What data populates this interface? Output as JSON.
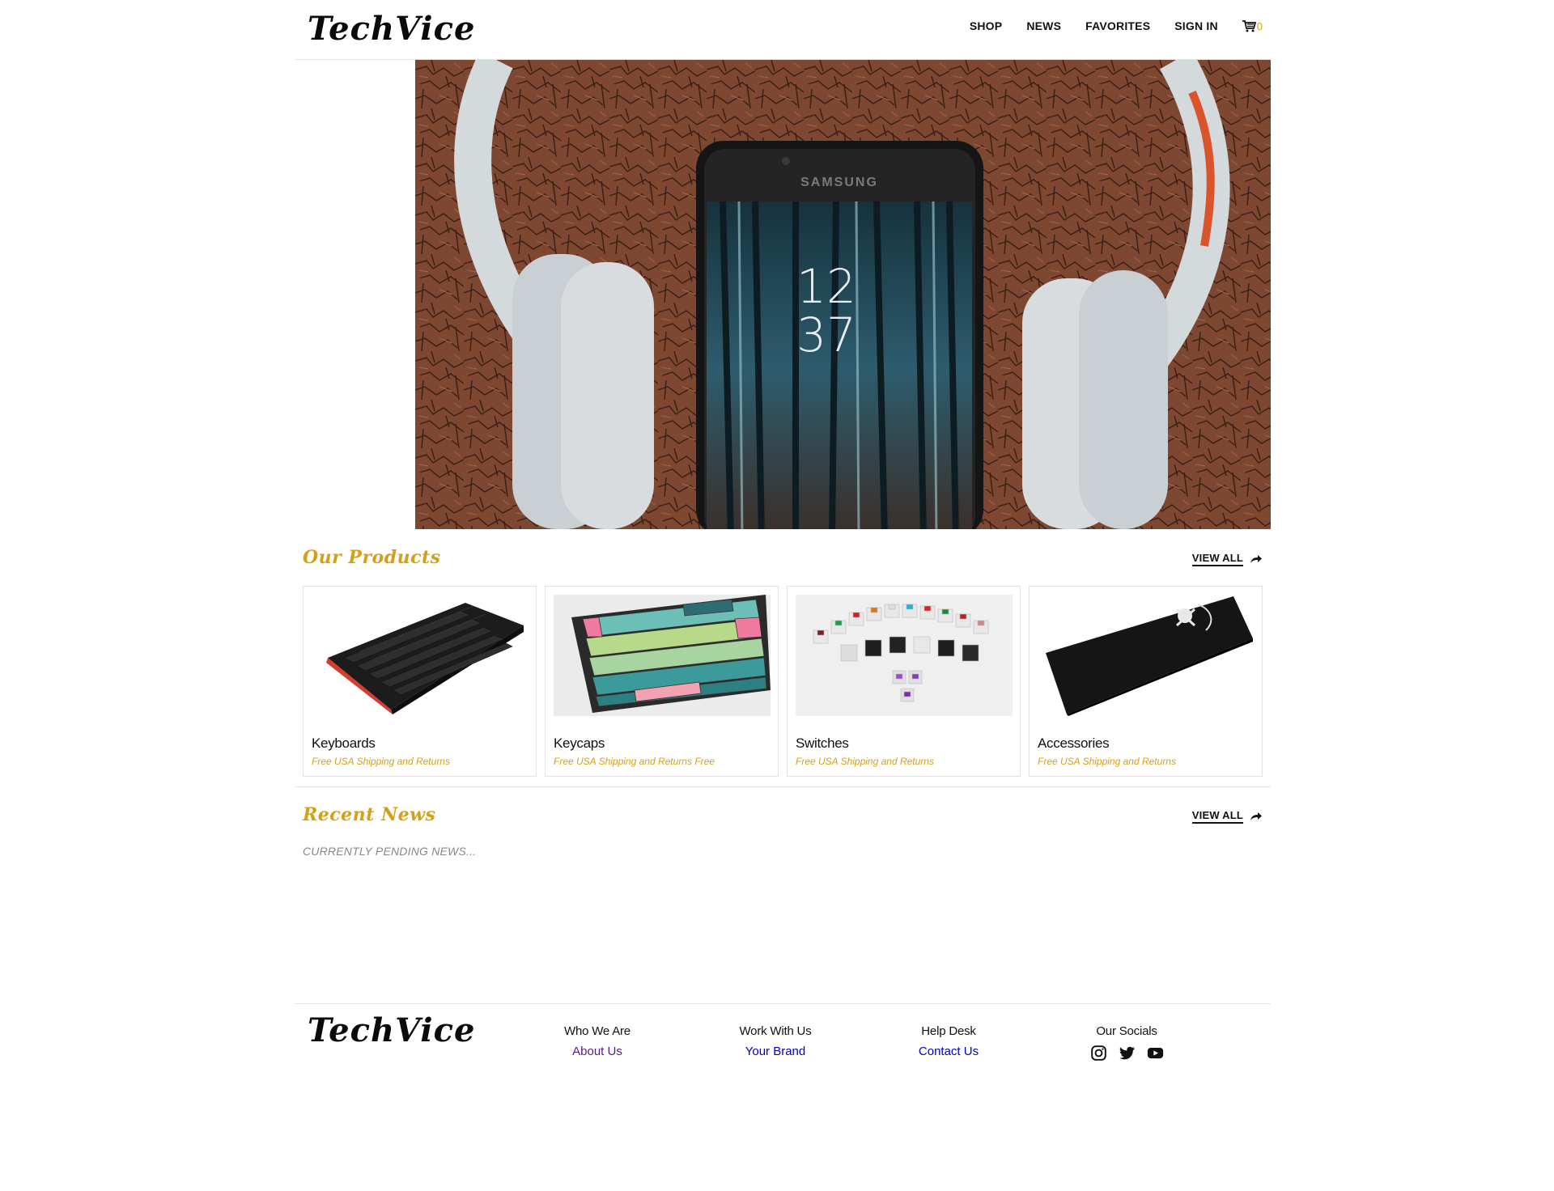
{
  "brand": {
    "name": "TechVice"
  },
  "nav": {
    "items": [
      "SHOP",
      "NEWS",
      "FAVORITES",
      "SIGN IN"
    ],
    "cart_icon": "cart-icon",
    "cart_count": "0"
  },
  "hero": {
    "image": "headphones-and-phone-photo"
  },
  "products": {
    "title": "Our Products",
    "view_all": "VIEW ALL",
    "view_all_icon": "share-arrow-icon",
    "items": [
      {
        "name": "Keyboards",
        "subtitle": "Free USA Shipping and Returns",
        "image": "keyboard-photo"
      },
      {
        "name": "Keycaps",
        "subtitle": "Free USA Shipping and Returns Free",
        "image": "keycaps-photo"
      },
      {
        "name": "Switches",
        "subtitle": "Free USA Shipping and Returns",
        "image": "switches-photo"
      },
      {
        "name": "Accessories",
        "subtitle": "Free USA Shipping and Returns",
        "image": "mousepad-photo"
      }
    ]
  },
  "news": {
    "title": "Recent News",
    "view_all": "VIEW ALL",
    "pending": "CURRENTLY PENDING NEWS..."
  },
  "footer": {
    "columns": [
      {
        "heading": "Who We Are",
        "link": "About Us",
        "link_color": "#551a8b"
      },
      {
        "heading": "Work With Us",
        "link": "Your Brand",
        "link_color": "#0000cc"
      },
      {
        "heading": "Help Desk",
        "link": "Contact Us",
        "link_color": "#0000cc"
      }
    ],
    "socials": {
      "heading": "Our Socials",
      "icons": [
        "instagram-icon",
        "twitter-icon",
        "youtube-icon"
      ]
    }
  },
  "colors": {
    "accent": "#d4a017",
    "text": "#111111",
    "divider": "#e4e4e4"
  }
}
